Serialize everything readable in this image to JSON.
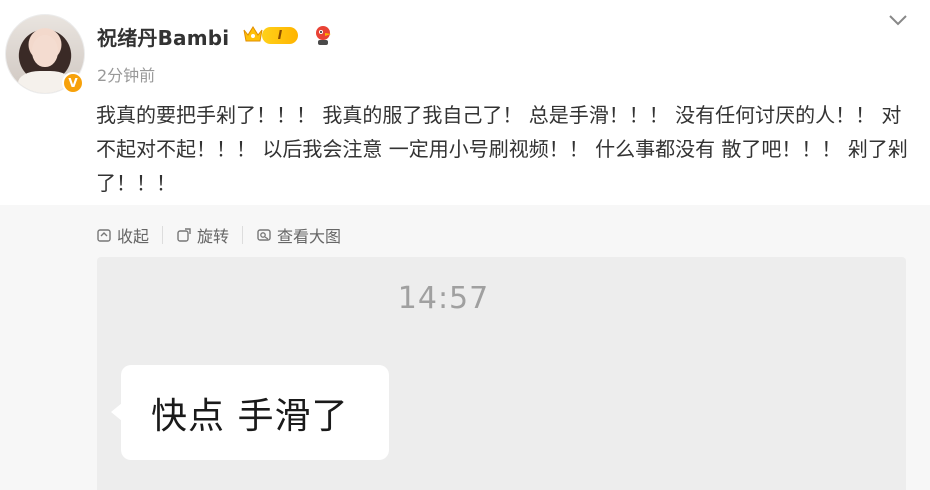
{
  "post": {
    "username": "祝绪丹Bambi",
    "level_badge": "I",
    "verified_badge": "V",
    "timestamp": "2分钟前",
    "text": "我真的要把手剁了！！！ 我真的服了我自己了！ 总是手滑！！！ 没有任何讨厌的人！！ 对不起对不起！！！ 以后我会注意 一定用小号刷视频！！ 什么事都没有 散了吧！！！ 剁了剁了！！！"
  },
  "toolbar": {
    "collapse_label": "收起",
    "rotate_label": "旋转",
    "view_large_label": "查看大图"
  },
  "image": {
    "clock_time": "14:57",
    "bubble_text": "快点 手滑了"
  },
  "colors": {
    "badge_orange": "#f7a10a",
    "level_gold": "#ffd11a",
    "panel_gray": "#ededed"
  }
}
